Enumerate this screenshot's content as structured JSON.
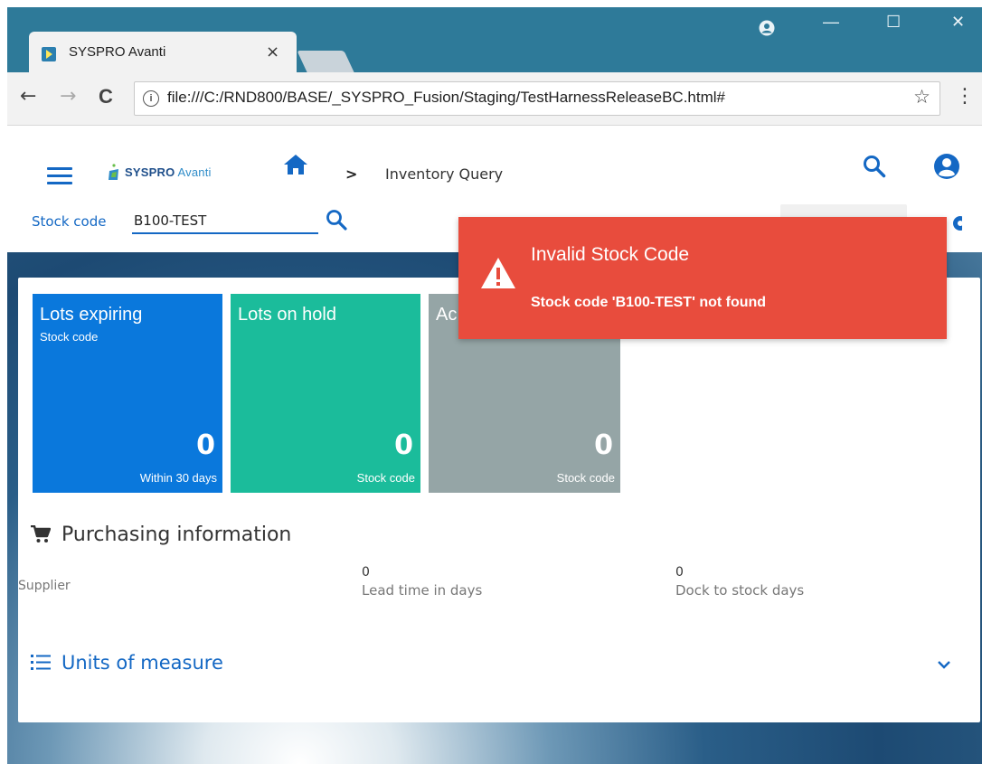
{
  "browser": {
    "tab_title": "SYSPRO Avanti",
    "tab_close": "×",
    "url_info": "i",
    "url": "file:///C:/RND800/BASE/_SYSPRO_Fusion/Staging/TestHarnessReleaseBC.html#",
    "star": "☆",
    "menu": "⋮",
    "back": "←",
    "forward": "→",
    "reload": "C",
    "minimize": "—",
    "maximize": "☐",
    "close": "✕"
  },
  "appbar": {
    "logo_brand": "SYSPRO",
    "logo_product": "Avanti",
    "breadcrumb_separator": ">",
    "breadcrumb_page": "Inventory Query"
  },
  "search": {
    "label": "Stock code",
    "value": "B100-TEST"
  },
  "tiles": [
    {
      "title": "Lots expiring",
      "subtitle": "Stock code",
      "value": "0",
      "footer": "Within 30 days",
      "color": "#0a78dc"
    },
    {
      "title": "Lots on hold",
      "subtitle": "",
      "value": "0",
      "footer": "Stock code",
      "color": "#1bbc9b"
    },
    {
      "title": "Ac",
      "subtitle": "",
      "value": "0",
      "footer": "Stock code",
      "color": "#95a5a6"
    }
  ],
  "purchasing": {
    "title": "Purchasing information",
    "supplier_label": "Supplier",
    "lead_time_value": "0",
    "lead_time_label": "Lead time in days",
    "dock_value": "0",
    "dock_label": "Dock to stock days"
  },
  "uom": {
    "title": "Units of measure"
  },
  "toast": {
    "title": "Invalid Stock Code",
    "message": "Stock code 'B100-TEST' not found",
    "color": "#e84c3d"
  },
  "colors": {
    "accent": "#1468c4",
    "chrome": "#2e7a99"
  }
}
